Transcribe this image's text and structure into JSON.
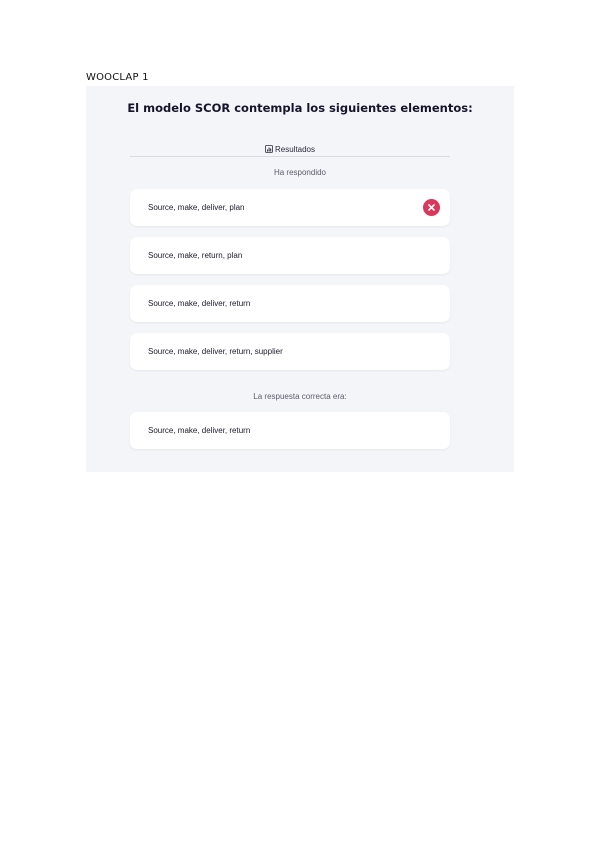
{
  "document": {
    "heading": "WOOCLAP 1"
  },
  "quiz": {
    "question": "El modelo SCOR contempla los siguientes elementos:",
    "results_tab_label": "Resultados",
    "results_tab_icon": "chart-icon",
    "answered_label": "Ha respondido",
    "correct_label": "La respuesta correcta era:",
    "wrong_color": "#d9375b",
    "options": [
      {
        "label": "Source, make, deliver, plan",
        "selected": true,
        "status": "wrong",
        "icon": "close-icon"
      },
      {
        "label": "Source, make, return, plan"
      },
      {
        "label": "Source, make, deliver, return"
      },
      {
        "label": "Source, make, deliver, return, supplier"
      }
    ],
    "correct_answer": "Source, make, deliver, return"
  }
}
